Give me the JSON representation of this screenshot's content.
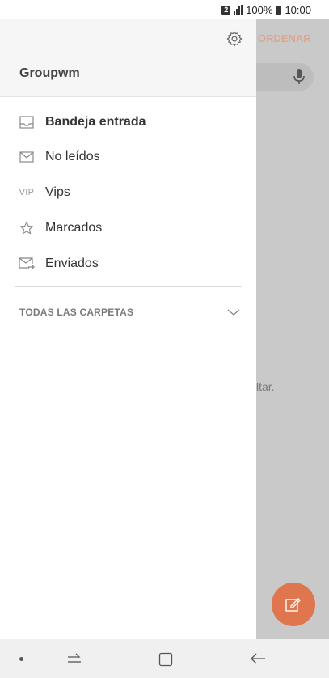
{
  "status_bar": {
    "sim_badge": "2",
    "battery": "100%",
    "time": "10:00"
  },
  "background": {
    "sort_label": "ORDENAR",
    "empty_hint": "ltar.",
    "accent_color": "#e0764d"
  },
  "drawer": {
    "account_name": "Groupwm",
    "items": [
      {
        "label": "Bandeja entrada",
        "icon": "inbox-icon",
        "active": true
      },
      {
        "label": "No leídos",
        "icon": "envelope-icon"
      },
      {
        "label": "Vips",
        "icon": "vip-icon",
        "icon_text": "VIP"
      },
      {
        "label": "Marcados",
        "icon": "star-icon"
      },
      {
        "label": "Enviados",
        "icon": "sent-icon"
      }
    ],
    "all_folders_label": "TODAS LAS CARPETAS"
  }
}
